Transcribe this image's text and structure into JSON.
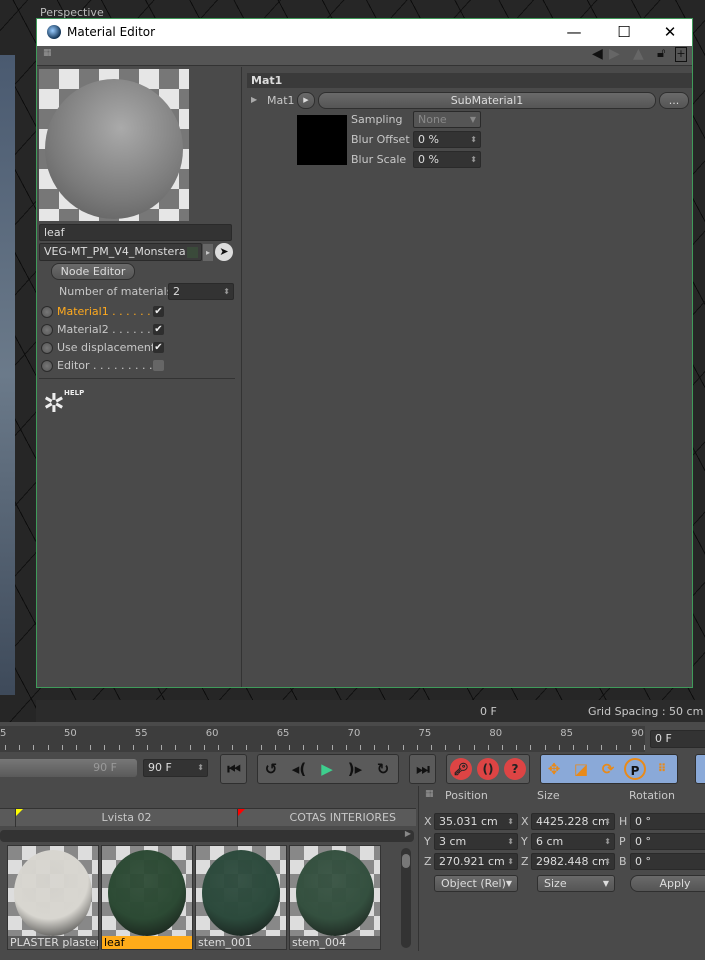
{
  "viewport": {
    "label": "Perspective",
    "frame": "0 F",
    "grid_spacing": "Grid Spacing : 50 cm"
  },
  "window": {
    "title": "Material Editor",
    "minimize": "—",
    "maximize": "☐",
    "close": "✕"
  },
  "left_panel": {
    "material_name": "leaf",
    "material_type": "VEG-MT_PM_V4_Monstera",
    "node_editor_label": "Node Editor",
    "num_materials_label": "Number of materials",
    "num_materials_value": "2",
    "channels": [
      {
        "label": "Material1 . . . . . . . .",
        "checked": true,
        "active": true
      },
      {
        "label": "Material2 . . . . . . .",
        "checked": true,
        "active": false
      },
      {
        "label": "Use displacement",
        "checked": true,
        "active": false
      },
      {
        "label": "Editor . . . . . . . . . .",
        "checked": false,
        "active": false
      }
    ],
    "help_label": "HELP"
  },
  "right_panel": {
    "section_title": "Mat1",
    "param_label": "Mat1",
    "submaterial": "SubMaterial1",
    "more_label": "...",
    "sampling_label": "Sampling",
    "sampling_value": "None",
    "blur_offset_label": "Blur Offset",
    "blur_offset_value": "0 %",
    "blur_scale_label": "Blur Scale",
    "blur_scale_value": "0 %"
  },
  "timeline": {
    "ticks": [
      "5",
      "50",
      "55",
      "60",
      "65",
      "70",
      "75",
      "80",
      "85",
      "90"
    ],
    "current_frame": "0 F",
    "end_frame_slider": "90 F",
    "end_frame": "90 F"
  },
  "takes": {
    "items": [
      "Lvista 02",
      "COTAS INTERIORES"
    ]
  },
  "materials": [
    {
      "name": "PLASTER plaster-pa",
      "color": "#d8d6d0",
      "selected": false
    },
    {
      "name": "leaf",
      "color": "#2c4a34",
      "selected": true
    },
    {
      "name": "stem_001",
      "color": "#2c4a3c",
      "selected": false
    },
    {
      "name": "stem_004",
      "color": "#34503f",
      "selected": false
    }
  ],
  "coords": {
    "headers": [
      "Position",
      "Size",
      "Rotation"
    ],
    "rows": [
      {
        "a": "X",
        "pos": "35.031 cm",
        "b": "X",
        "size": "4425.228 cm",
        "c": "H",
        "rot": "0 °"
      },
      {
        "a": "Y",
        "pos": "3 cm",
        "b": "Y",
        "size": "6 cm",
        "c": "P",
        "rot": "0 °"
      },
      {
        "a": "Z",
        "pos": "270.921 cm",
        "b": "Z",
        "size": "2982.448 cm",
        "c": "B",
        "rot": "0 °"
      }
    ],
    "mode": "Object (Rel)",
    "size_mode": "Size",
    "apply": "Apply"
  },
  "colors": {
    "accent": "#ffaa1e",
    "selection": "#ffab19",
    "play": "#3ecf8e"
  }
}
